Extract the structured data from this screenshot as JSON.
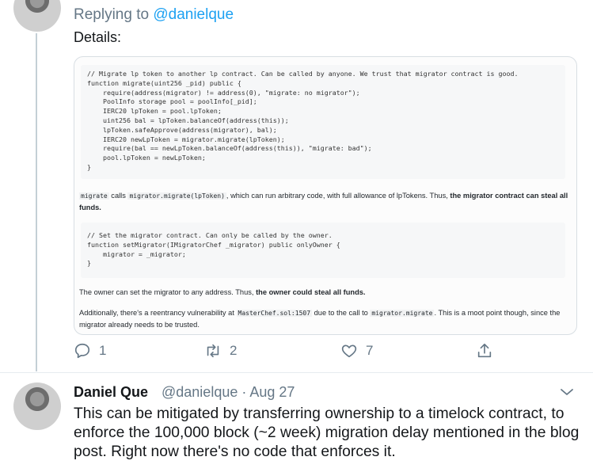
{
  "reply": {
    "replying_prefix": "Replying to ",
    "replying_handle": "@danielque",
    "details": "Details:"
  },
  "card": {
    "code1": "// Migrate lp token to another lp contract. Can be called by anyone. We trust that migrator contract is good.\nfunction migrate(uint256 _pid) public {\n    require(address(migrator) != address(0), \"migrate: no migrator\");\n    PoolInfo storage pool = poolInfo[_pid];\n    IERC20 lpToken = pool.lpToken;\n    uint256 bal = lpToken.balanceOf(address(this));\n    lpToken.safeApprove(address(migrator), bal);\n    IERC20 newLpToken = migrator.migrate(lpToken);\n    require(bal == newLpToken.balanceOf(address(this)), \"migrate: bad\");\n    pool.lpToken = newLpToken;\n}",
    "para1_code_a": "migrate",
    "para1_text_a": " calls ",
    "para1_code_b": "migrator.migrate(lpToken)",
    "para1_text_b": ", which can run arbitrary code, with full allowance of lpTokens. Thus, ",
    "para1_bold": "the migrator contract can steal all funds.",
    "code2": "// Set the migrator contract. Can only be called by the owner.\nfunction setMigrator(IMigratorChef _migrator) public onlyOwner {\n    migrator = _migrator;\n}",
    "para2_text": "The owner can set the migrator to any address. Thus, ",
    "para2_bold": "the owner could steal all funds.",
    "para3_text_a": "Additionally, there's a reentrancy vulnerability at ",
    "para3_code_a": "MasterChef.sol:1507",
    "para3_text_b": " due to the call to ",
    "para3_code_b": "migrator.migrate",
    "para3_text_c": ". This is a moot point though, since the migrator already needs to be trusted."
  },
  "actions": {
    "reply_count": "1",
    "retweet_count": "2",
    "like_count": "7",
    "icons": [
      "reply-icon",
      "retweet-icon",
      "like-icon",
      "share-icon"
    ]
  },
  "next_tweet": {
    "name": "Daniel Que",
    "handle_date": "@danielque · Aug 27",
    "text": "This can be mitigated by transferring ownership to a timelock contract, to enforce the 100,000 block (~2 week) migration delay mentioned in the blog post. Right now there's no code that enforces it."
  },
  "colors": {
    "link": "#1da1f2",
    "muted": "#657786",
    "text": "#14171a"
  }
}
